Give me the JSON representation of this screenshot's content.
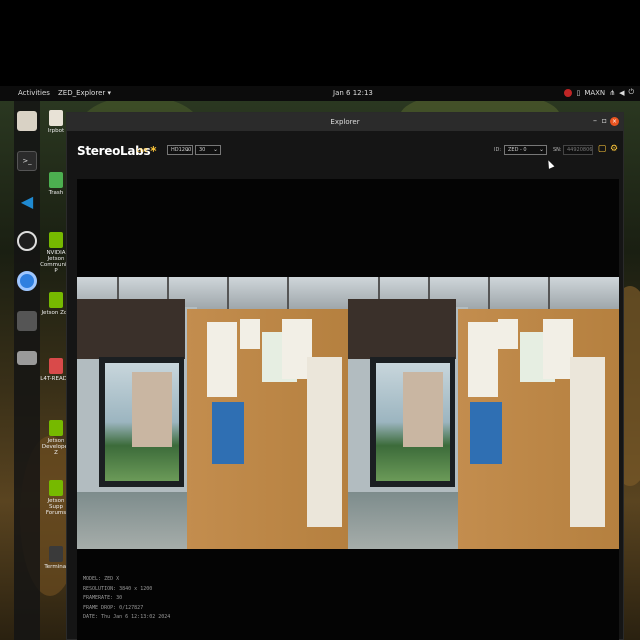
{
  "topbar": {
    "activities": "Activities",
    "app_menu": "ZED_Explorer ▾",
    "clock": "Jan 6 12:13",
    "power_mode": "MAXN"
  },
  "dock": {
    "items": [
      {
        "icon": "files-icon",
        "color": "#d9d2c5"
      },
      {
        "icon": "terminal-icon",
        "color": "#2b2b2b"
      },
      {
        "icon": "vscode-icon",
        "color": "#1f8ad2"
      },
      {
        "icon": "obs-icon",
        "color": "#1e1e1e"
      },
      {
        "icon": "chromium-icon",
        "color": "#2f7fe0"
      },
      {
        "icon": "app-icon",
        "color": "#555555"
      },
      {
        "icon": "drive-icon",
        "color": "#9a9a9a"
      }
    ]
  },
  "desktop_icons": [
    {
      "label": "lrpbot",
      "color": "#e8e2d6"
    },
    {
      "label": "Trash",
      "color": "#4caf50"
    },
    {
      "label": "NVIDIA Jetson Community P",
      "color": "#76b900"
    },
    {
      "label": "Jetson Zoo",
      "color": "#76b900"
    },
    {
      "label": "L4T-READM",
      "color": "#d94a4a"
    },
    {
      "label": "Jetson Developer Z",
      "color": "#76b900"
    },
    {
      "label": "Jetson Supp Forums",
      "color": "#76b900"
    },
    {
      "label": "Terminal",
      "color": "#3a3a3a"
    }
  ],
  "window": {
    "title": "Explorer",
    "minimize": "–",
    "maximize": "▫",
    "close": "×"
  },
  "toolbar": {
    "brand": "StereoLabs",
    "brand_star": "*",
    "live": "LIVE",
    "resolution": "HD1200",
    "fps": "30",
    "id_label": "ID:",
    "id_value": "ZED - 0",
    "sn_label": "SN:",
    "sn_value": "44920806"
  },
  "meta": {
    "model": "MODEL: ZED X",
    "resolution": "RESOLUTION: 3840 x 1200",
    "framerate": "FRAMERATE: 30",
    "frame_drop": "FRAME DROP: 0/127827",
    "date": "DATE: Thu Jan 6 12:13:02 2024"
  },
  "colors": {
    "accent": "#ffc83a",
    "close": "#e95420"
  }
}
